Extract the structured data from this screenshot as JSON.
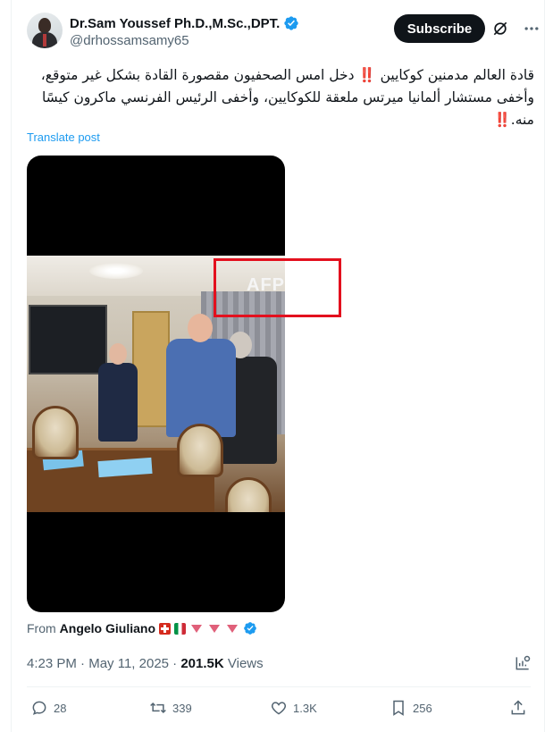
{
  "author": {
    "name": "Dr.Sam Youssef Ph.D.,M.Sc.,DPT.",
    "handle": "@drhossamsamy65"
  },
  "header": {
    "subscribe_label": "Subscribe",
    "grok_icon": "grok-icon",
    "more_icon": "more-icon"
  },
  "post": {
    "text": "قادة العالم مدمنين كوكايين ‼️ دخل امس الصحفيون مقصورة القادة بشكل غير متوقع، وأخفى مستشار ألمانيا ميرتس ملعقة للكوكايين، وأخفى الرئيس الفرنسي ماكرون كيسًا منه.‼️",
    "translate_label": "Translate post"
  },
  "media": {
    "watermark": "AFP",
    "highlight_color": "#e3101e"
  },
  "source": {
    "from_label": "From",
    "name": "Angelo Giuliano"
  },
  "meta": {
    "time": "4:23 PM",
    "separator": "·",
    "date": "May 11, 2025",
    "views_count": "201.5K",
    "views_label": "Views"
  },
  "actions": {
    "replies": "28",
    "reposts": "339",
    "likes": "1.3K",
    "bookmarks": "256"
  },
  "colors": {
    "accent": "#1d9bf0",
    "text": "#0f1419",
    "secondary": "#536471",
    "button_bg": "#0f1419"
  }
}
